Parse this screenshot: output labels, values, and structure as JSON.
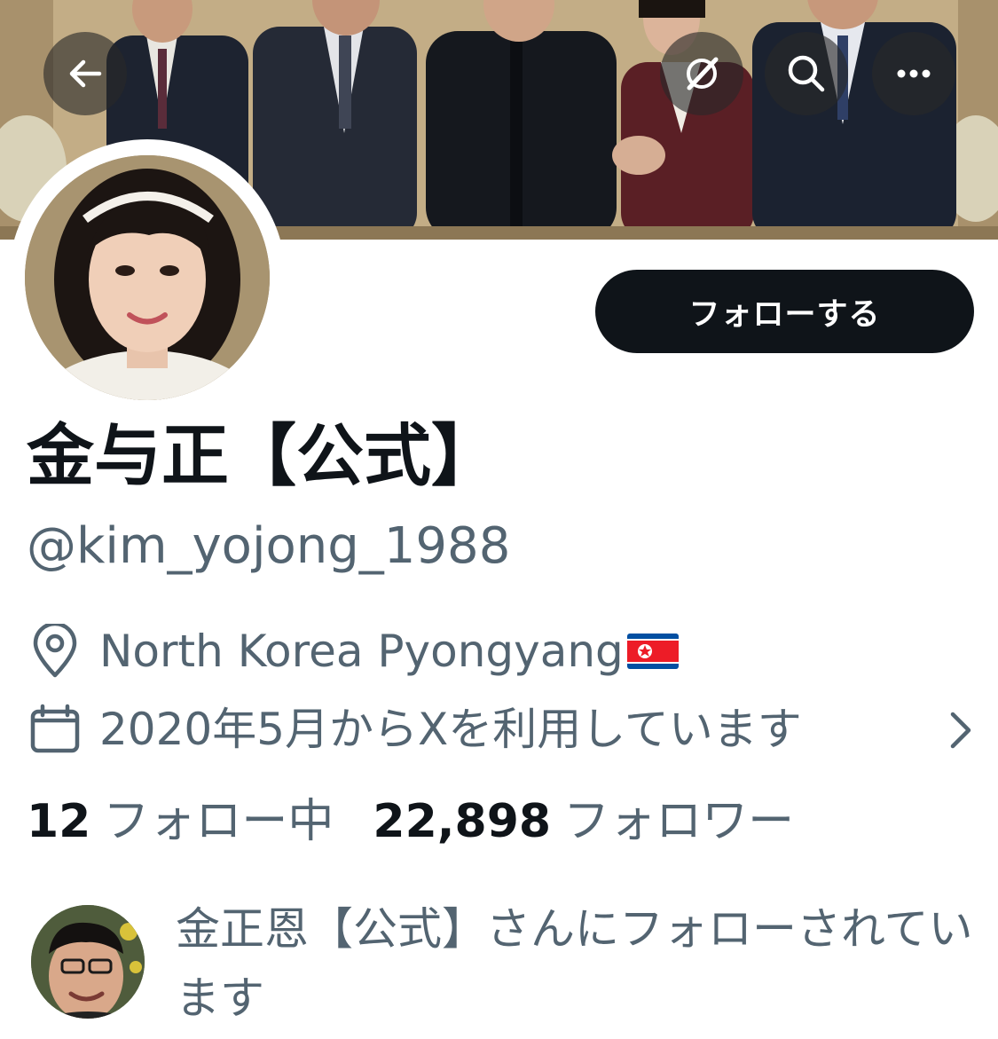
{
  "header": {
    "back_icon": "arrow-left-icon",
    "grok_icon": "grok-icon",
    "search_icon": "search-icon",
    "more_icon": "more-horizontal-icon"
  },
  "profile": {
    "display_name": "金与正【公式】",
    "handle": "@kim_yojong_1988",
    "location": "North Korea Pyongyang",
    "location_flag": "north-korea-flag",
    "joined": "2020年5月からXを利用しています",
    "following_count": "12",
    "following_label": "フォロー中",
    "followers_count": "22,898",
    "followers_label": "フォロワー",
    "followed_by_text": "金正恩【公式】さんにフォローされています"
  },
  "actions": {
    "follow_label": "フォローする"
  },
  "colors": {
    "primary_text": "#0f1419",
    "secondary_text": "#536471",
    "button_bg": "#0f1419",
    "button_text": "#ffffff",
    "overlay_button": "#282828"
  }
}
